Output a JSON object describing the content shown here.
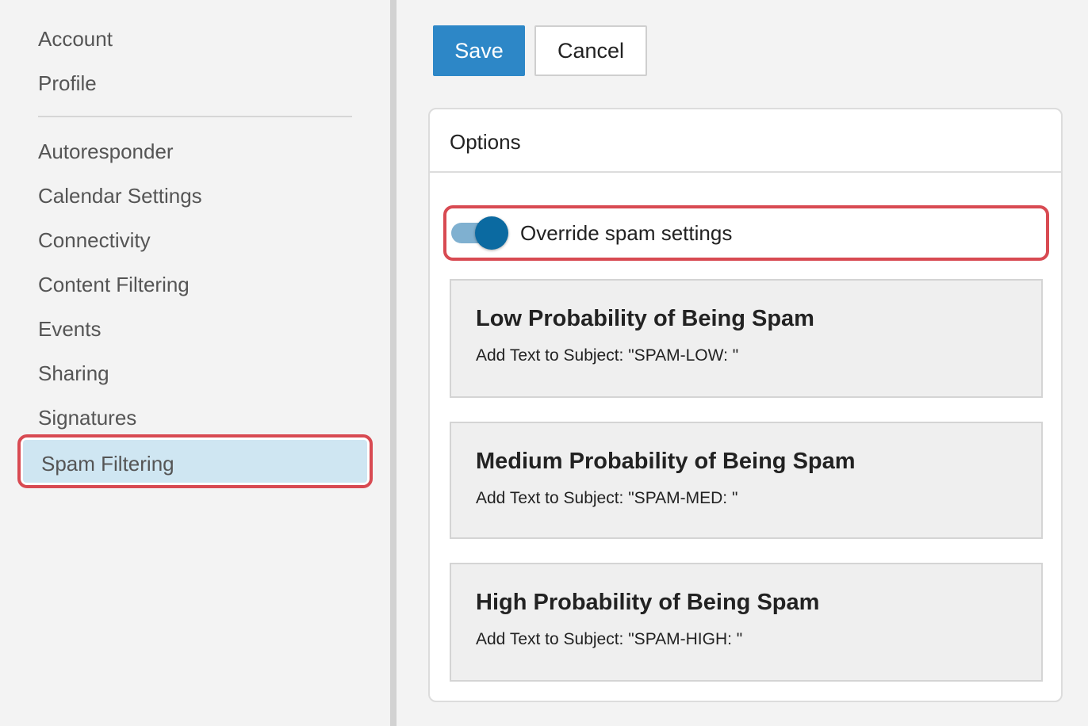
{
  "sidebar": {
    "items_top": [
      {
        "label": "Account"
      },
      {
        "label": "Profile"
      }
    ],
    "items_bottom": [
      {
        "label": "Autoresponder"
      },
      {
        "label": "Calendar Settings"
      },
      {
        "label": "Connectivity"
      },
      {
        "label": "Content Filtering"
      },
      {
        "label": "Events"
      },
      {
        "label": "Sharing"
      },
      {
        "label": "Signatures"
      }
    ],
    "selected": {
      "label": "Spam Filtering"
    }
  },
  "toolbar": {
    "save_label": "Save",
    "cancel_label": "Cancel"
  },
  "options": {
    "title": "Options",
    "override_toggle": {
      "label": "Override spam settings",
      "checked": true
    },
    "levels": [
      {
        "title": "Low Probability of Being Spam",
        "desc": "Add Text to Subject: \"SPAM-LOW: \""
      },
      {
        "title": "Medium Probability of Being Spam",
        "desc": "Add Text to Subject: \"SPAM-MED: \""
      },
      {
        "title": "High Probability of Being Spam",
        "desc": "Add Text to Subject: \"SPAM-HIGH: \""
      }
    ]
  },
  "colors": {
    "accent": "#2d87c7",
    "highlight_border": "#d84a52",
    "selected_bg": "#cfe6f2",
    "toggle_on": "#0b6aa1"
  }
}
